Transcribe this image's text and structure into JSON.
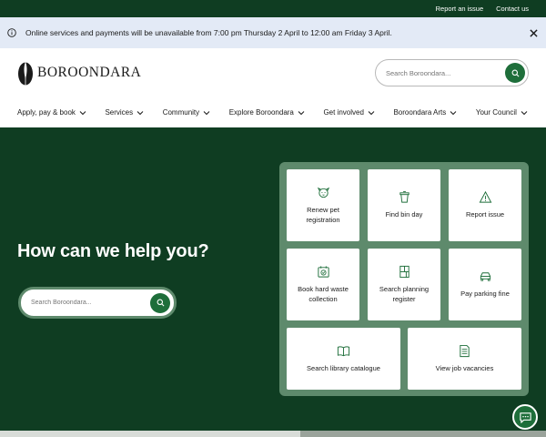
{
  "topbar": {
    "report_issue": "Report an issue",
    "contact_us": "Contact us"
  },
  "alert": {
    "message": "Online services and payments will be unavailable from 7:00 pm Thursday 2 April to 12:00 am Friday 3 April."
  },
  "header": {
    "logo_text": "Boroondara",
    "search_placeholder": "Search Boroondara..."
  },
  "nav": {
    "items": [
      {
        "label": "Apply, pay & book"
      },
      {
        "label": "Services"
      },
      {
        "label": "Community"
      },
      {
        "label": "Explore Boroondara"
      },
      {
        "label": "Get involved"
      },
      {
        "label": "Boroondara Arts"
      },
      {
        "label": "Your Council"
      }
    ]
  },
  "hero": {
    "title": "How can we help you?",
    "search_placeholder": "Search Boroondara..."
  },
  "quick_links": [
    {
      "label": "Renew pet registration",
      "icon": "pet-icon"
    },
    {
      "label": "Find bin day",
      "icon": "bin-icon"
    },
    {
      "label": "Report issue",
      "icon": "warning-icon"
    },
    {
      "label": "Book hard waste collection",
      "icon": "hard-waste-icon"
    },
    {
      "label": "Search planning register",
      "icon": "planning-icon"
    },
    {
      "label": "Pay parking fine",
      "icon": "car-icon"
    },
    {
      "label": "Search library catalogue",
      "icon": "book-icon"
    },
    {
      "label": "View job vacancies",
      "icon": "document-icon"
    }
  ],
  "colors": {
    "dark_green": "#0f3d22",
    "accent_green": "#1e6e3a",
    "panel_green": "#5e8a6c",
    "alert_bg": "#e3eaf6"
  }
}
